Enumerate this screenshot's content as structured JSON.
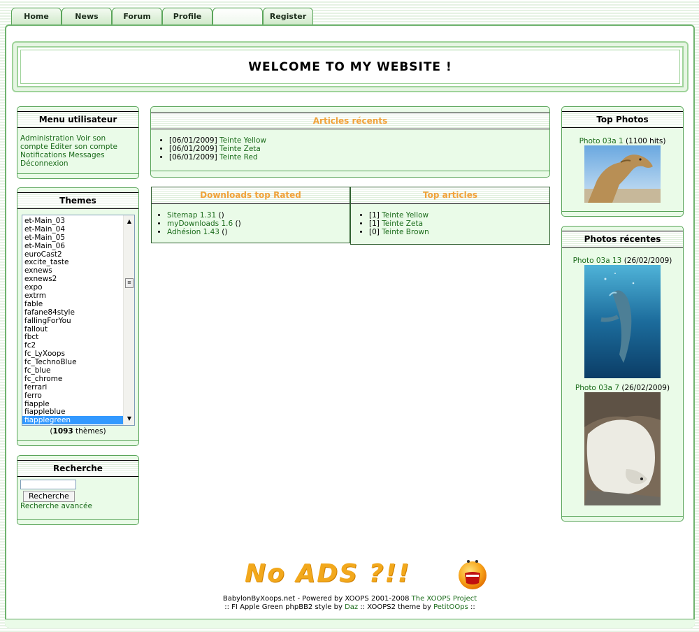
{
  "nav": {
    "tabs": [
      "Home",
      "News",
      "Forum",
      "Profile",
      "",
      "Register"
    ]
  },
  "header": {
    "title": "WELCOME TO MY WEBSITE !"
  },
  "user_menu": {
    "title": "Menu utilisateur",
    "items": [
      "Administration",
      "Voir son compte",
      "Editer son compte",
      "Notifications",
      "Messages",
      "Déconnexion"
    ]
  },
  "themes": {
    "title": "Themes",
    "options": [
      "et-Main_03",
      "et-Main_04",
      "et-Main_05",
      "et-Main_06",
      "euroCast2",
      "excite_taste",
      "exnews",
      "exnews2",
      "expo",
      "extrm",
      "fable",
      "fafane84style",
      "fallingForYou",
      "fallout",
      "fbct",
      "fc2",
      "fc_LyXoops",
      "fc_TechnoBlue",
      "fc_blue",
      "fc_chrome",
      "ferrari",
      "ferro",
      "fiapple",
      "fiappleblue",
      "fiapplegreen"
    ],
    "selected": "fiapplegreen",
    "count": "1093",
    "count_suffix": " thèmes)",
    "count_prefix": "("
  },
  "search": {
    "title": "Recherche",
    "button": "Recherche",
    "advanced": "Recherche avancée"
  },
  "recent_articles": {
    "title": "Articles récents",
    "items": [
      {
        "date": "[06/01/2009]",
        "title": "Teinte Yellow"
      },
      {
        "date": "[06/01/2009]",
        "title": "Teinte Zeta"
      },
      {
        "date": "[06/01/2009]",
        "title": "Teinte Red"
      }
    ]
  },
  "downloads": {
    "title": "Downloads top Rated",
    "items": [
      {
        "name": "Sitemap 1.31",
        "suffix": " ()"
      },
      {
        "name": "myDownloads 1.6",
        "suffix": " ()"
      },
      {
        "name": "Adhésion 1.43",
        "suffix": " ()"
      }
    ]
  },
  "top_articles": {
    "title": "Top articles",
    "items": [
      {
        "rank": "[1]",
        "title": "Teinte Yellow"
      },
      {
        "rank": "[1]",
        "title": "Teinte Zeta"
      },
      {
        "rank": "[0]",
        "title": "Teinte Brown"
      }
    ]
  },
  "top_photos": {
    "title": "Top Photos",
    "caption_link": "Photo 03a 1",
    "caption_extra": " (1100 hits)"
  },
  "recent_photos": {
    "title": "Photos récentes",
    "items": [
      {
        "link": "Photo 03a 13",
        "extra": " (26/02/2009)"
      },
      {
        "link": "Photo 03a 7",
        "extra": " (26/02/2009)"
      }
    ]
  },
  "footer": {
    "noads": "No ADS ?!!",
    "line1_text": "BabylonByXoops.net - Powered by XOOPS 2001-2008 ",
    "line1_link": "The XOOPS Project",
    "line2_a": ":: FI Apple Green phpBB2 style by ",
    "line2_link1": "Daz",
    "line2_b": " :: XOOPS2 theme by ",
    "line2_link2": "PetitOOps",
    "line2_c": " ::"
  },
  "colors": {
    "accent": "#f0a23a",
    "link": "#1a6b1a",
    "block_bg": "#eafbe8",
    "border": "#5aa55a",
    "selected": "#3399ff"
  }
}
